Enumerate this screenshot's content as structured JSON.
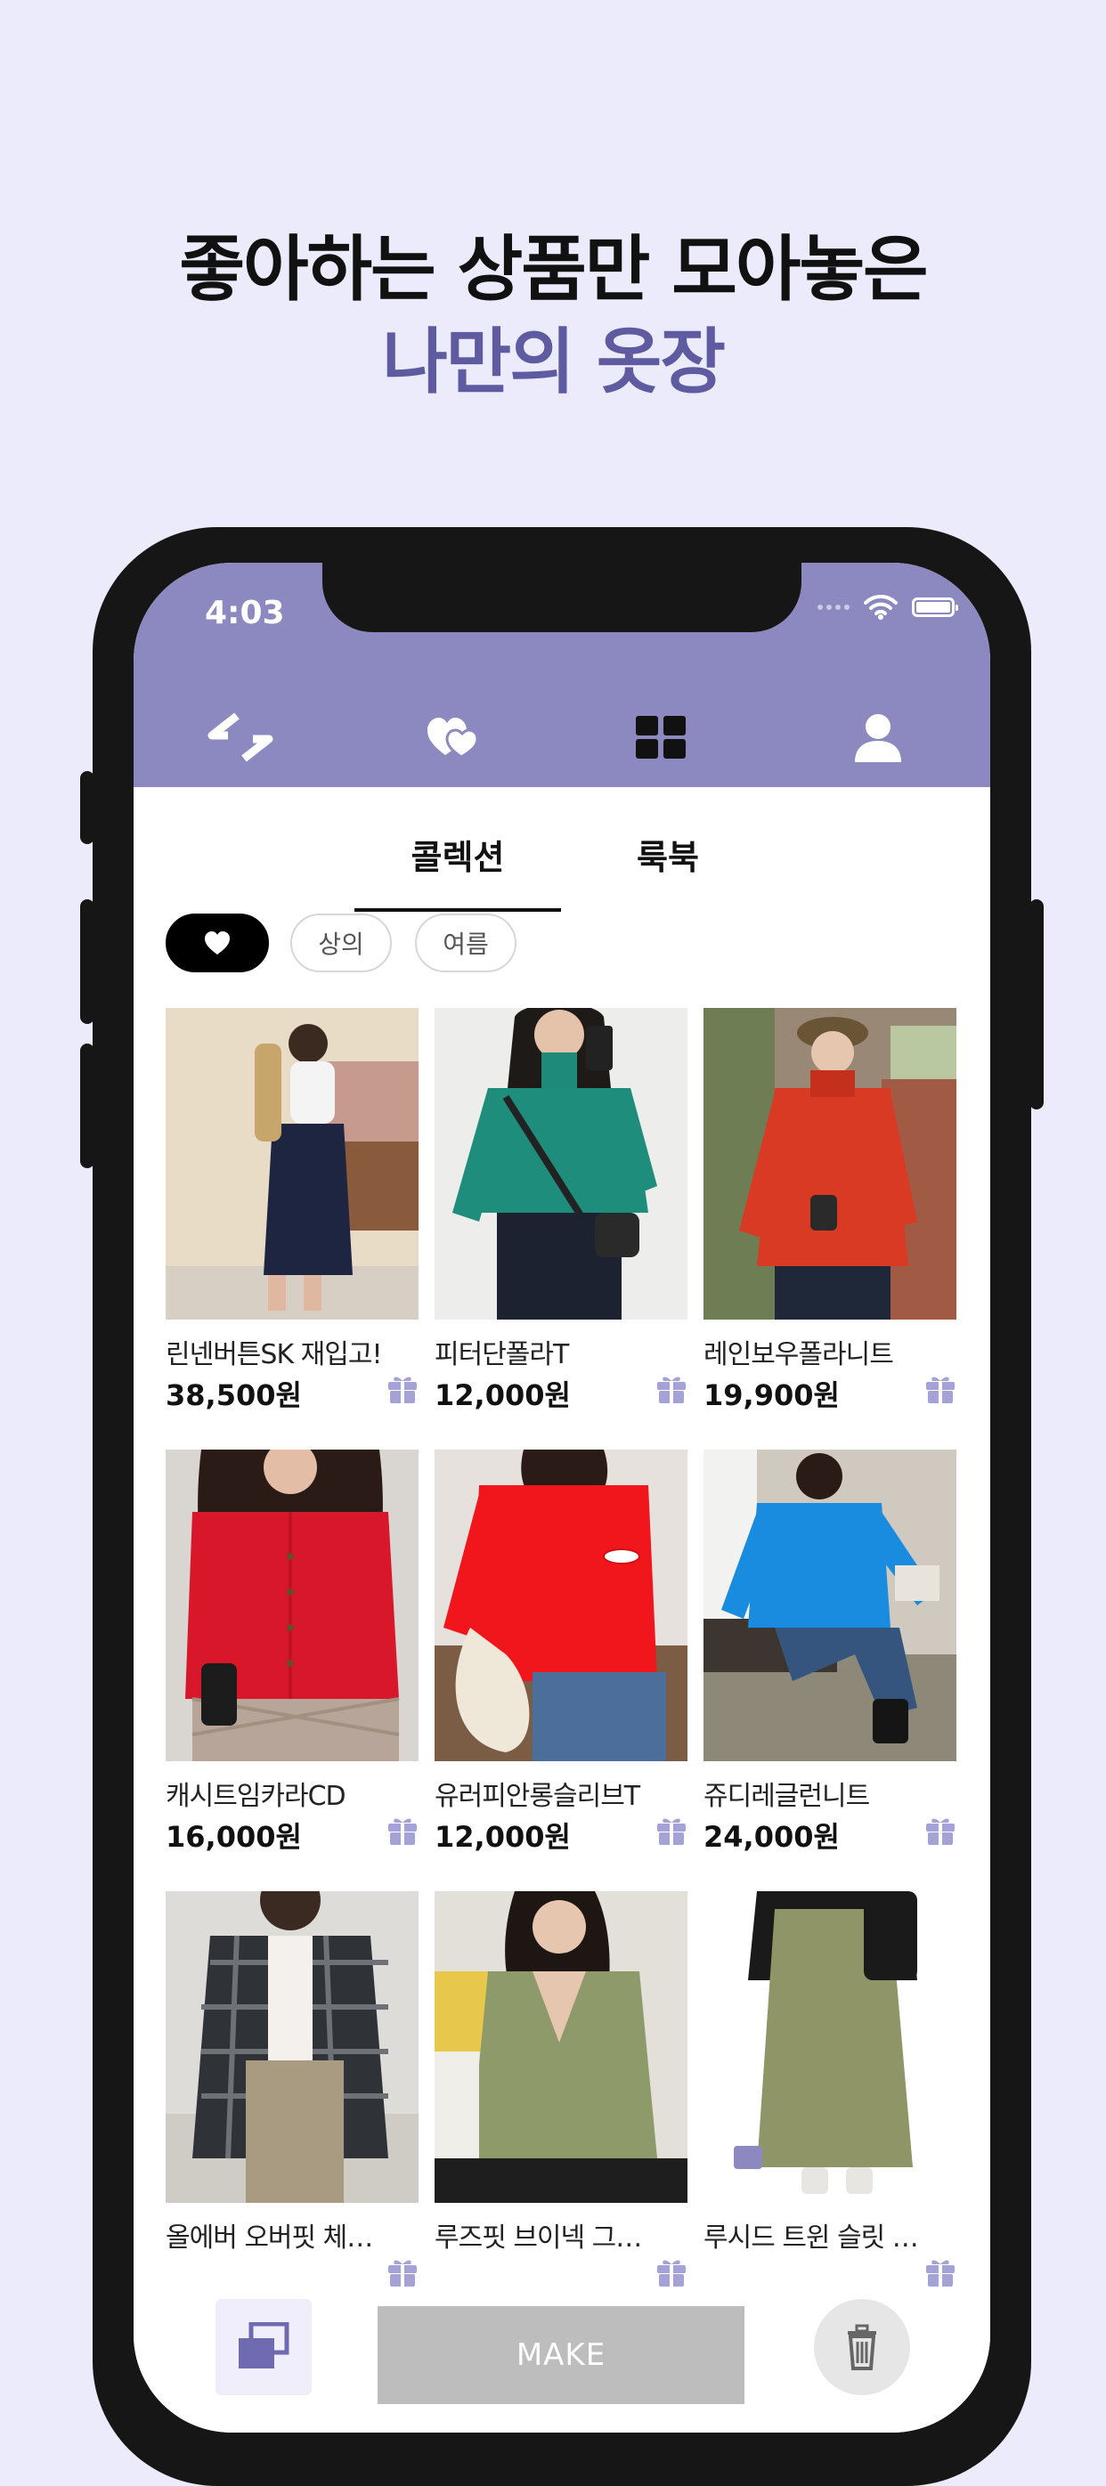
{
  "headline": {
    "line1": "좋아하는 상품만 모아놓은",
    "line2": "나만의 옷장"
  },
  "status_bar": {
    "time": "4:03"
  },
  "nav": {
    "icons": [
      "logo-icon",
      "hearts-icon",
      "grid-icon",
      "profile-icon"
    ],
    "accent_color": "#8B89C0"
  },
  "tabs": [
    {
      "label": "콜렉션",
      "active": true
    },
    {
      "label": "룩북",
      "active": false
    }
  ],
  "filters": [
    {
      "label": "",
      "icon": "heart-icon",
      "active": true
    },
    {
      "label": "상의",
      "active": false
    },
    {
      "label": "여름",
      "active": false
    }
  ],
  "products": [
    {
      "name": "린넨버튼SK 재입고!",
      "price": "38,500원"
    },
    {
      "name": "피터단폴라T",
      "price": "12,000원"
    },
    {
      "name": "레인보우폴라니트",
      "price": "19,900원"
    },
    {
      "name": "캐시트임카라CD",
      "price": "16,000원"
    },
    {
      "name": "유러피안롱슬리브T",
      "price": "12,000원"
    },
    {
      "name": "쥬디레글런니트",
      "price": "24,000원"
    },
    {
      "name": "올에버 오버핏 체…",
      "price": ""
    },
    {
      "name": "루즈핏 브이넥 그…",
      "price": ""
    },
    {
      "name": "루시드 트윈 슬릿 …",
      "price": ""
    }
  ],
  "bottom_bar": {
    "make_label": "MAKE"
  }
}
